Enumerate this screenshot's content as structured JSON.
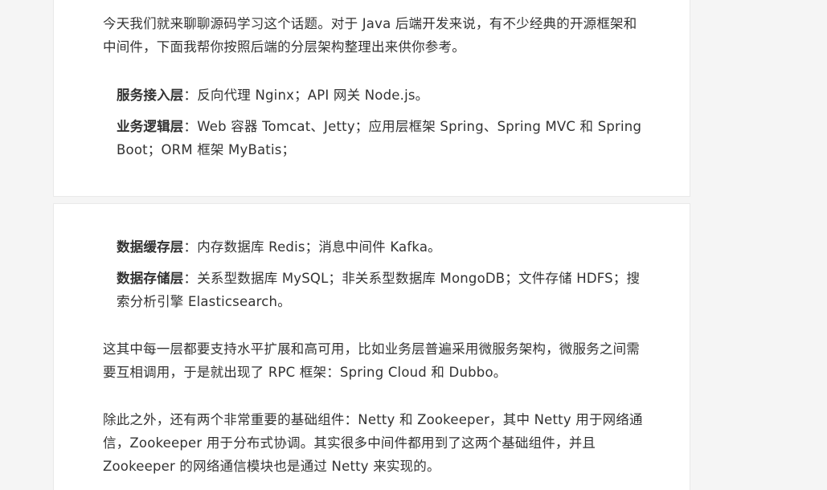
{
  "card1": {
    "intro_line1": "今天我们就来聊聊源码学习这个话题。对于 Java 后端开发来说，有不少经典的开源框架和",
    "intro_line2": "中间件，下面我帮你按照后端的分层架构整理出来供你参考。",
    "items": [
      {
        "title": "服务接入层",
        "text_line1": "：反向代理 Nginx；API 网关 Node.js。",
        "text_line2": ""
      },
      {
        "title": "业务逻辑层",
        "text_line1": "：Web 容器 Tomcat、Jetty；应用层框架 Spring、Spring MVC 和 Spring",
        "text_line2": "Boot；ORM 框架 MyBatis；"
      }
    ]
  },
  "card2": {
    "items": [
      {
        "title": "数据缓存层",
        "text_line1": "：内存数据库 Redis；消息中间件 Kafka。",
        "text_line2": ""
      },
      {
        "title": "数据存储层",
        "text_line1": "：关系型数据库 MySQL；非关系型数据库 MongoDB；文件存储 HDFS；搜",
        "text_line2": "索分析引擎 Elasticsearch。"
      }
    ],
    "para1_line1": "这其中每一层都要支持水平扩展和高可用，比如业务层普遍采用微服务架构，微服务之间需",
    "para1_line2": "要互相调用，于是就出现了 RPC 框架：Spring Cloud 和 Dubbo。",
    "para2_line1": "除此之外，还有两个非常重要的基础组件：Netty 和 Zookeeper，其中 Netty 用于网络通",
    "para2_line2": "信，Zookeeper 用于分布式协调。其实很多中间件都用到了这两个基础组件，并且",
    "para2_line3": "Zookeeper 的网络通信模块也是通过 Netty 来实现的。"
  }
}
